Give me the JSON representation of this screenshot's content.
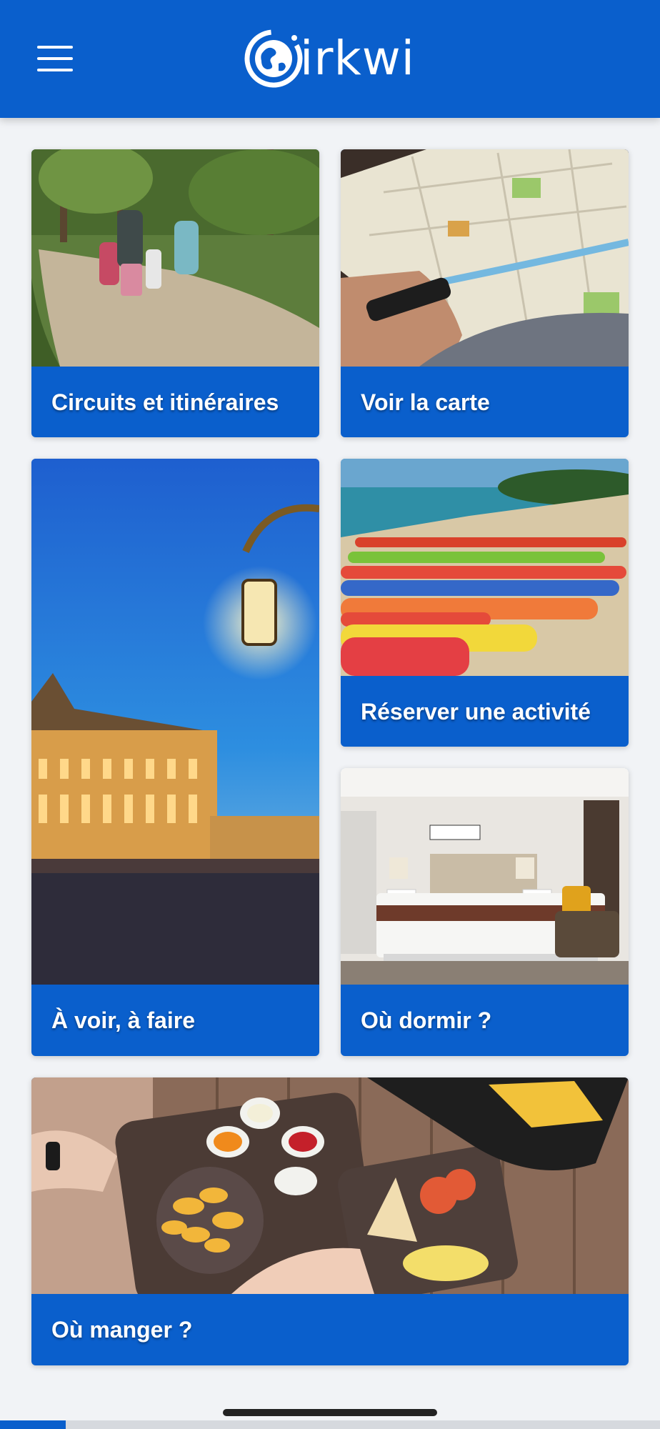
{
  "header": {
    "menu_icon": "hamburger-menu-icon",
    "logo_icon": "globe-icon",
    "logo_text": "irkwi"
  },
  "cards": [
    {
      "label": "Circuits et itinéraires",
      "image": "family-forest-trail-photo"
    },
    {
      "label": "Voir la carte",
      "image": "paper-map-photo"
    },
    {
      "label": "À voir, à faire",
      "image": "illuminated-square-lantern-photo"
    },
    {
      "label": "Réserver une activité",
      "image": "kayaks-beach-photo"
    },
    {
      "label": "Où dormir ?",
      "image": "hotel-bedroom-photo"
    },
    {
      "label": "Où manger ?",
      "image": "food-table-photo"
    }
  ],
  "colors": {
    "brand": "#0a5fcc",
    "background": "#f1f3f6"
  }
}
